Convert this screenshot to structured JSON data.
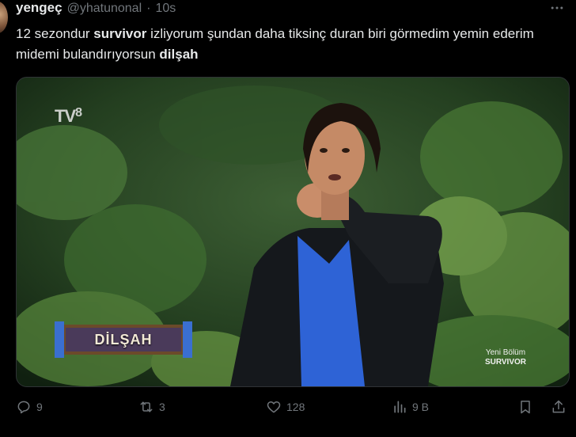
{
  "tweet": {
    "display_name": "yengeç",
    "handle": "@yhatunonal",
    "separator": "·",
    "time": "10s",
    "text_parts": {
      "p1": "12 sezondur ",
      "b1": "survivor",
      "p2": " izliyorum şundan daha tiksinç duran biri görmedim yemin ederim midemi bulandırıyorsun ",
      "b2": "dilşah"
    }
  },
  "media": {
    "watermark_tv": "TV",
    "watermark_num": "8",
    "nameplate": "DİLŞAH",
    "corner_line1": "Yeni Bölüm",
    "corner_line2": "SURVIVOR"
  },
  "actions": {
    "replies": "9",
    "reposts": "3",
    "likes": "128",
    "views": "9 B"
  },
  "icons": {
    "more": "more-icon",
    "reply": "reply-icon",
    "repost": "repost-icon",
    "like": "heart-icon",
    "views": "views-icon",
    "bookmark": "bookmark-icon",
    "share": "share-icon"
  },
  "colors": {
    "background": "#000000",
    "text": "#e7e9ea",
    "muted": "#71767b"
  }
}
